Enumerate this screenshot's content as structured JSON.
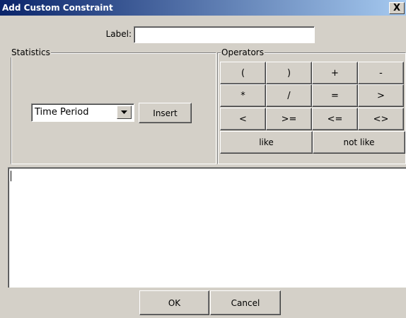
{
  "window": {
    "title": "Add Custom Constraint",
    "close_glyph": "X"
  },
  "label_row": {
    "label": "Label:",
    "value": ""
  },
  "statistics": {
    "legend": "Statistics",
    "selected": "Time Period",
    "insert_label": "Insert"
  },
  "operators": {
    "legend": "Operators",
    "row1": [
      "(",
      ")",
      "+",
      "-"
    ],
    "row2": [
      "*",
      "/",
      "=",
      ">"
    ],
    "row3": [
      "<",
      ">=",
      "<=",
      "<>"
    ],
    "row4": [
      "like",
      "not like"
    ]
  },
  "expression": {
    "value": ""
  },
  "buttons": {
    "ok": "OK",
    "cancel": "Cancel"
  }
}
